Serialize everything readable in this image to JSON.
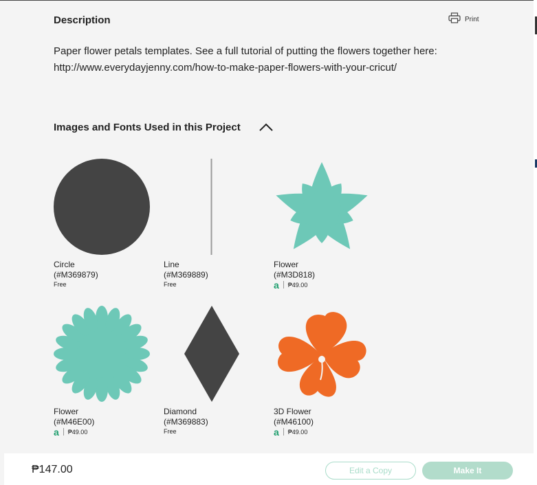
{
  "description": {
    "title": "Description",
    "print_label": "Print",
    "text": "Paper flower petals templates. See a full tutorial of putting the flowers together here: http://www.everydayjenny.com/how-to-make-paper-flowers-with-your-cricut/"
  },
  "images_section": {
    "title": "Images and Fonts Used in this Project",
    "items": [
      {
        "name": "Circle",
        "code": "(#M369879)",
        "price": "Free",
        "access": false,
        "color": "#444444"
      },
      {
        "name": "Line",
        "code": "(#M369889)",
        "price": "Free",
        "access": false,
        "color": "#9a9a9a"
      },
      {
        "name": "Flower",
        "code": "(#M3D818)",
        "price": "₱49.00",
        "access": true,
        "color": "#6dc8b7"
      },
      {
        "name": "Flower",
        "code": "(#M46E00)",
        "price": "₱49.00",
        "access": true,
        "color": "#6dc8b7"
      },
      {
        "name": "Diamond",
        "code": "(#M369883)",
        "price": "Free",
        "access": false,
        "color": "#444444"
      },
      {
        "name": "3D Flower",
        "code": "(#M46100)",
        "price": "₱49.00",
        "access": true,
        "color": "#ef6a25"
      }
    ],
    "access_icon": "a"
  },
  "footer": {
    "total": "₱147.00",
    "edit_copy_label": "Edit a Copy",
    "make_it_label": "Make It"
  },
  "colors": {
    "accent_green": "#1f9e6e",
    "button_mint": "#b2dccb"
  }
}
